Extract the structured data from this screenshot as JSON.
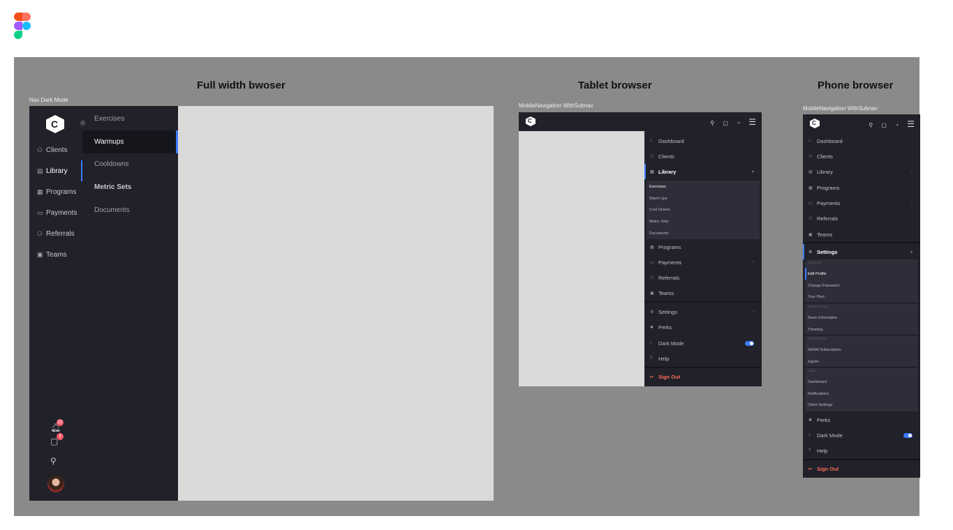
{
  "logo_icon": "figma-icon",
  "frames": {
    "full_title": "Full width bwoser",
    "tablet_title": "Tablet browser",
    "phone_title": "Phone browser",
    "full_label": "Nav Dark Mode",
    "tablet_label": "MobileNavigation WithSubnav",
    "phone_label": "MobileNavigation WithSubnav"
  },
  "full": {
    "rail": [
      {
        "label": "Clients",
        "icon": "users-icon"
      },
      {
        "label": "Library",
        "icon": "book-icon",
        "active": true
      },
      {
        "label": "Programs",
        "icon": "calendar-icon"
      },
      {
        "label": "Payments",
        "icon": "card-icon"
      },
      {
        "label": "Referrals",
        "icon": "referral-icon"
      },
      {
        "label": "Teams",
        "icon": "teams-icon"
      }
    ],
    "bell_count": "22",
    "chat_count": "3",
    "subnav": [
      {
        "label": "Exercises"
      },
      {
        "label": "Warmups",
        "active": true
      },
      {
        "label": "Cooldowns"
      },
      {
        "label": "Metric Sets",
        "bold": true
      },
      {
        "label": "Documents"
      }
    ]
  },
  "tablet": {
    "menu": [
      "Dashboard",
      "Clients",
      "Library"
    ],
    "library_sub": [
      "Exercises",
      "Warm Ups",
      "Cool Downs",
      "Metric Sets",
      "Documents"
    ],
    "menu2": [
      "Programs",
      "Payments",
      "Referrals",
      "Teams"
    ],
    "menu3": [
      "Settings",
      "Perks",
      "Dark Mode",
      "Help"
    ],
    "signout": "Sign Out"
  },
  "phone": {
    "menu": [
      "Dashboard",
      "Clients",
      "Library",
      "Programs",
      "Payments",
      "Referrals",
      "Teams"
    ],
    "settings": "Settings",
    "groups": [
      {
        "heading": "ACCOUNT",
        "items": [
          "Edit Profile",
          "Change Password",
          "Your Plan"
        ]
      },
      {
        "heading": "ORGANIZATION",
        "items": [
          "Basic Information",
          "Theming"
        ]
      },
      {
        "heading": "INTEGRATION",
        "items": [
          "NASM Subscription",
          "Zapier"
        ]
      },
      {
        "heading": "USER",
        "items": [
          "Dashboard",
          "Notifications",
          "Client Settings"
        ]
      }
    ],
    "menu3": [
      "Perks",
      "Dark Mode",
      "Help"
    ],
    "signout": "Sign Out"
  },
  "colors": {
    "accent": "#3d7bff",
    "nav_bg": "#21212a",
    "danger": "#ff6b5b",
    "canvas": "#8a8a8a"
  }
}
